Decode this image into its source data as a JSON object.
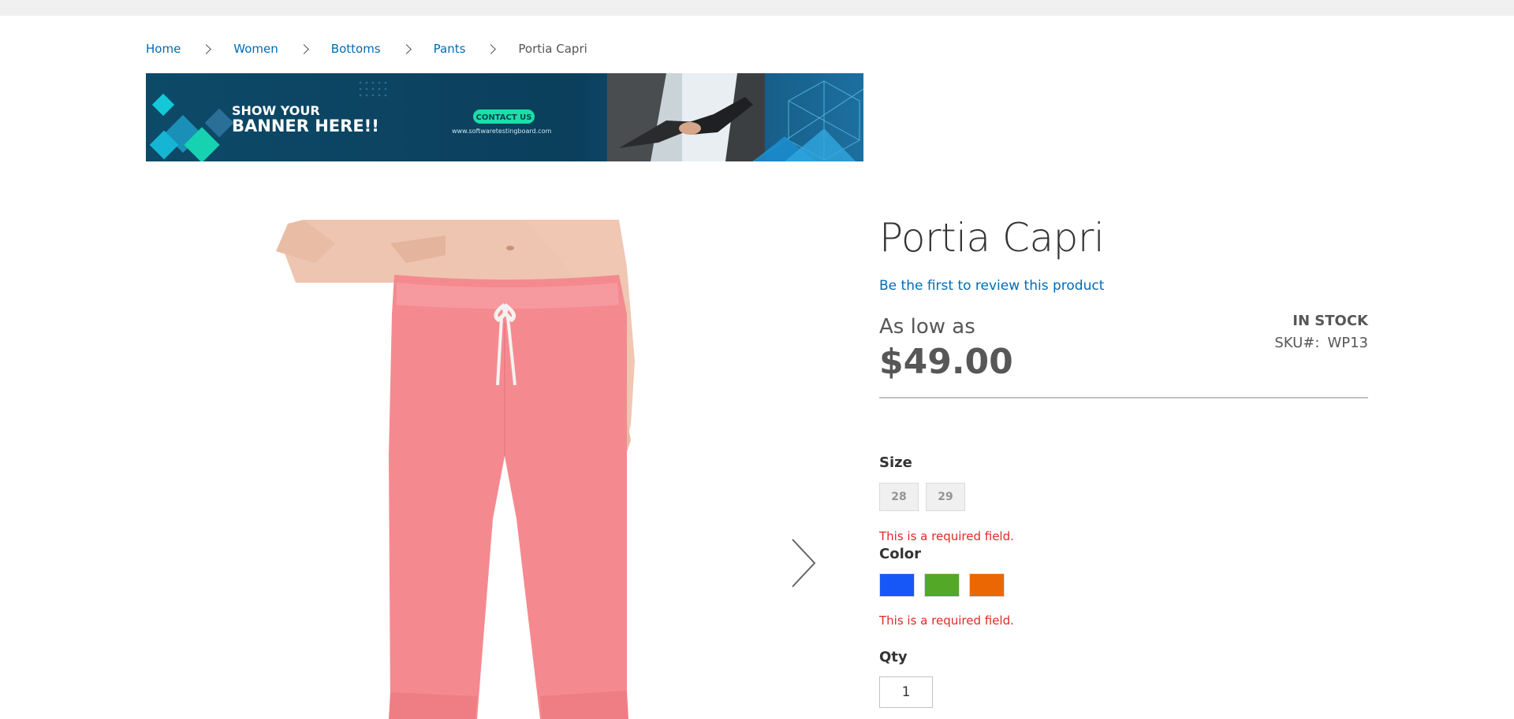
{
  "breadcrumb": {
    "items": [
      {
        "label": "Home"
      },
      {
        "label": "Women"
      },
      {
        "label": "Bottoms"
      },
      {
        "label": "Pants"
      }
    ],
    "current": "Portia Capri"
  },
  "banner": {
    "headline_line1": "SHOW YOUR",
    "headline_line2": "BANNER HERE!!",
    "cta": "CONTACT US",
    "url": "www.softwaretestingboard.com"
  },
  "gallery": {
    "image_icon": "pink-capri-pants-photo",
    "next_icon": "chevron-right-icon",
    "pants_color": "#f48a8f"
  },
  "product": {
    "title": "Portia Capri",
    "review_link": "Be the first to review this product",
    "price_label": "As low as",
    "price": "$49.00",
    "stock": "IN STOCK",
    "sku_label": "SKU#:",
    "sku": "WP13"
  },
  "options": {
    "size_label": "Size",
    "sizes": [
      "28",
      "29"
    ],
    "size_error": "This is a required field.",
    "color_label": "Color",
    "colors": [
      "#1857f7",
      "#53a828",
      "#eb6703"
    ],
    "color_error": "This is a required field.",
    "qty_label": "Qty",
    "qty_value": "1"
  },
  "colors": {
    "link": "#006bb4",
    "error": "#e02b27",
    "text": "#333333",
    "price": "#575757"
  }
}
